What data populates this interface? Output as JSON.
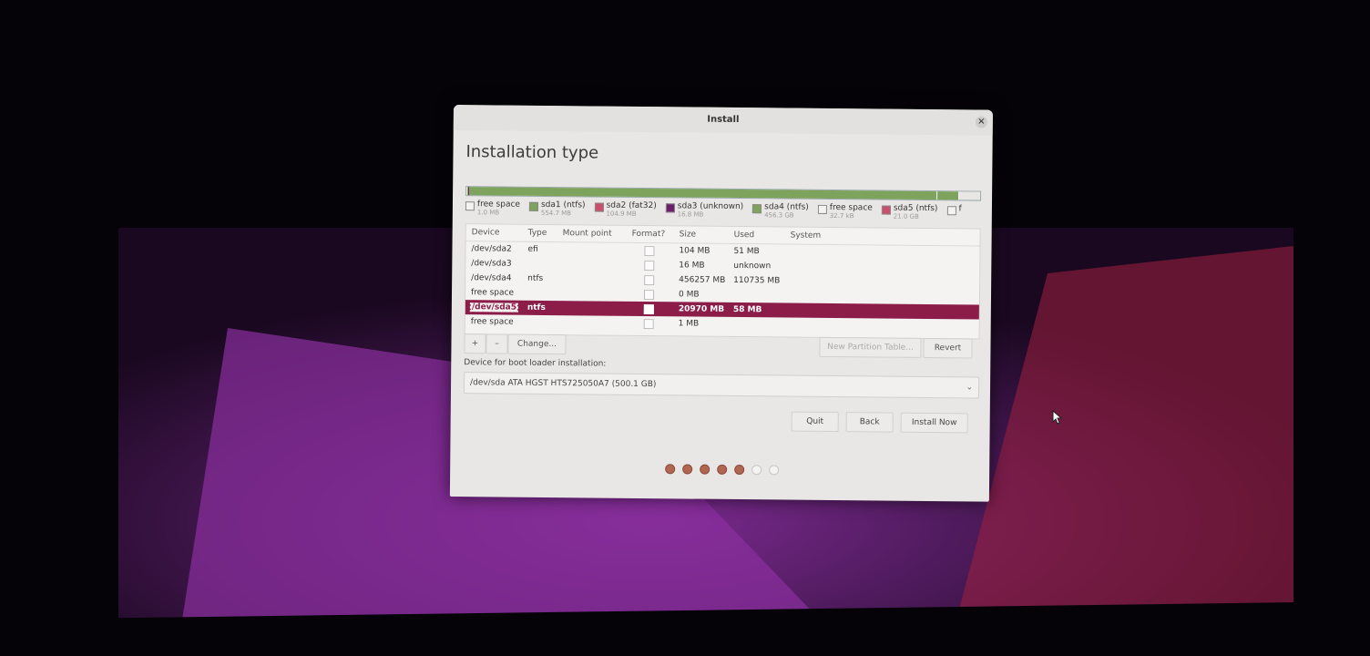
{
  "window": {
    "title": "Install",
    "close_icon": "close-icon"
  },
  "page": {
    "heading": "Installation type"
  },
  "partition_bar": {
    "segments": [
      {
        "name": "free space",
        "fraction": 0.002,
        "color": "#f4f3f2"
      },
      {
        "name": "sda1 (ntfs)",
        "fraction": 0.001,
        "color": "#7ea35c"
      },
      {
        "name": "sda2 (fat32)",
        "fraction": 0.001,
        "color": "#c8506e"
      },
      {
        "name": "sda3 (unknown)",
        "fraction": 0.001,
        "color": "#6a1f6a"
      },
      {
        "name": "sda4 (ntfs)",
        "fraction": 0.91,
        "color": "#7ea35c"
      },
      {
        "name": "free space",
        "fraction": 0.001,
        "color": "#f4f3f2"
      },
      {
        "name": "sda5 (ntfs)",
        "fraction": 0.042,
        "color": "#7ea35c"
      },
      {
        "name": "free space",
        "fraction": 0.002,
        "color": "#f4f3f2"
      }
    ]
  },
  "legend": [
    {
      "name": "free space",
      "size": "1.0 MB",
      "color": "#f4f3f2"
    },
    {
      "name": "sda1 (ntfs)",
      "size": "554.7 MB",
      "color": "#7ea35c"
    },
    {
      "name": "sda2 (fat32)",
      "size": "104.9 MB",
      "color": "#c8506e"
    },
    {
      "name": "sda3 (unknown)",
      "size": "16.8 MB",
      "color": "#6a1f6a"
    },
    {
      "name": "sda4 (ntfs)",
      "size": "456.3 GB",
      "color": "#7ea35c"
    },
    {
      "name": "free space",
      "size": "32.7 kB",
      "color": "#f4f3f2"
    },
    {
      "name": "sda5 (ntfs)",
      "size": "21.0 GB",
      "color": "#c8506e"
    },
    {
      "name": "f",
      "size": "",
      "color": "#f4f3f2"
    }
  ],
  "table": {
    "headers": {
      "device": "Device",
      "type": "Type",
      "mount": "Mount point",
      "format": "Format?",
      "size": "Size",
      "used": "Used",
      "system": "System"
    },
    "rows": [
      {
        "device": "/dev/sda2",
        "type": "efi",
        "mount": "",
        "size": "104 MB",
        "used": "51 MB",
        "system": "",
        "format_checked": false,
        "has_format": true,
        "selected": false
      },
      {
        "device": "/dev/sda3",
        "type": "",
        "mount": "",
        "size": "16 MB",
        "used": "unknown",
        "system": "",
        "format_checked": false,
        "has_format": true,
        "selected": false
      },
      {
        "device": "/dev/sda4",
        "type": "ntfs",
        "mount": "",
        "size": "456257 MB",
        "used": "110735 MB",
        "system": "",
        "format_checked": false,
        "has_format": true,
        "selected": false
      },
      {
        "device": "free space",
        "type": "",
        "mount": "",
        "size": "0 MB",
        "used": "",
        "system": "",
        "format_checked": false,
        "has_format": true,
        "selected": false
      },
      {
        "device": "/dev/sda5",
        "type": "ntfs",
        "mount": "",
        "size": "20970 MB",
        "used": "58 MB",
        "system": "",
        "format_checked": false,
        "has_format": true,
        "selected": true
      },
      {
        "device": "free space",
        "type": "",
        "mount": "",
        "size": "1 MB",
        "used": "",
        "system": "",
        "format_checked": false,
        "has_format": true,
        "selected": false
      }
    ]
  },
  "table_toolbar": {
    "add": "+",
    "remove": "–",
    "change": "Change...",
    "new_table": "New Partition Table...",
    "revert": "Revert"
  },
  "boot_loader": {
    "label": "Device for boot loader installation:",
    "value": "/dev/sda   ATA HGST HTS725050A7 (500.1 GB)",
    "chevron": "chevron-down-icon"
  },
  "actions": {
    "quit": "Quit",
    "back": "Back",
    "install": "Install Now"
  },
  "progress": {
    "total": 7,
    "done": 5,
    "done_color": "#b06650",
    "todo_color": "#f4f3f2"
  }
}
